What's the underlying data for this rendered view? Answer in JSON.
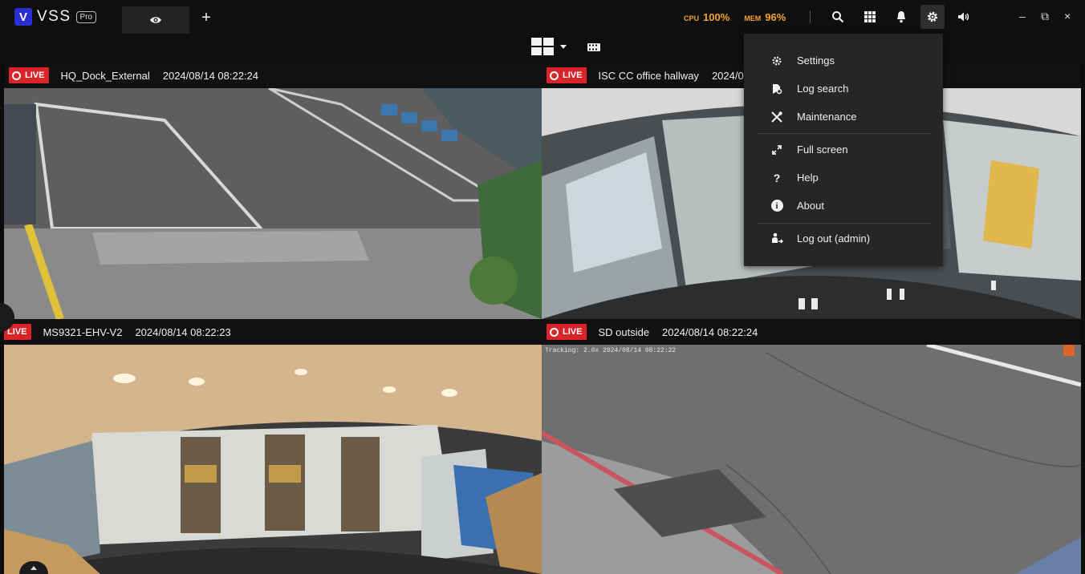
{
  "app": {
    "logo_letter": "V",
    "name": "VSS",
    "badge": "Pro"
  },
  "tabs": [
    {
      "icon": "eye-icon"
    }
  ],
  "add_tab_label": "+",
  "stats": {
    "cpu_label": "CPU",
    "cpu_value": "100%",
    "mem_label": "MEM",
    "mem_value": "96%",
    "color": "#f2a52a"
  },
  "toolbar_icons": [
    "search-icon",
    "apps-grid-icon",
    "bell-icon",
    "gear-icon",
    "volume-icon"
  ],
  "window_controls": {
    "minimize": "–",
    "restore": "⧉",
    "close": "×"
  },
  "tiles": [
    {
      "live": "LIVE",
      "name": "HQ_Dock_External",
      "time": "2024/08/14 08:22:24"
    },
    {
      "live": "LIVE",
      "name": "ISC CC office hallway",
      "time": "2024/08"
    },
    {
      "live": "LIVE",
      "name": "MS9321-EHV-V2",
      "time": "2024/08/14 08:22:23"
    },
    {
      "live": "LIVE",
      "name": "SD outside",
      "time": "2024/08/14 08:22:24",
      "overlay": "Tracking: 2.0x 2024/08/14 08:22:22"
    }
  ],
  "menu": {
    "items": [
      {
        "label": "Settings",
        "icon": "gear-icon"
      },
      {
        "label": "Log search",
        "icon": "log-search-icon"
      },
      {
        "label": "Maintenance",
        "icon": "tools-icon"
      },
      {
        "label": "Full screen",
        "icon": "fullscreen-icon"
      },
      {
        "label": "Help",
        "icon": "help-icon",
        "glyph": "?"
      },
      {
        "label": "About",
        "icon": "info-icon",
        "glyph": "i"
      },
      {
        "label": "Log out (admin)",
        "icon": "logout-icon"
      }
    ]
  },
  "colors": {
    "live_badge": "#d9252a",
    "selection": "#3d7fd6",
    "brand": "#2a2fd0"
  }
}
